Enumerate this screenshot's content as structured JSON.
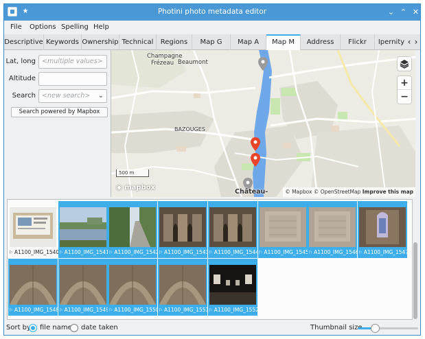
{
  "window": {
    "title": "Photini photo metadata editor",
    "controls": {
      "minimize": "⌄",
      "maximize": "⌃",
      "close": "✕"
    }
  },
  "menubar": [
    "File",
    "Options",
    "Spelling",
    "Help"
  ],
  "tabs": {
    "items": [
      "Descriptive",
      "Keywords",
      "Ownership",
      "Technical",
      "Regions",
      "Map G",
      "Map A",
      "Map M",
      "Address",
      "Flickr",
      "Ipernity"
    ],
    "active": "Map M",
    "scroll_left": "‹",
    "scroll_right": "›"
  },
  "location": {
    "latlong_label": "Lat, long",
    "latlong_placeholder": "<multiple values>",
    "altitude_label": "Altitude",
    "altitude_value": "",
    "search_label": "Search",
    "search_placeholder": "<new search>",
    "search_button": "Search powered by Mapbox"
  },
  "map": {
    "places": [
      "Champagne",
      "Frézeau",
      "Beaumont",
      "BAZOUGES",
      "Château-"
    ],
    "scale": "500 m",
    "zoom_in": "+",
    "zoom_out": "−",
    "logo": "mapbox",
    "attribution": "© Mapbox © OpenStreetMap",
    "improve": "Improve this map",
    "colors": {
      "river": "#6fa8e8",
      "park": "#c8e6b0",
      "urban": "#dedcd2",
      "marker": "#e8442a",
      "marker_grey": "#9a9a9a"
    }
  },
  "thumbnails": [
    {
      "caption": "A1100_IMG_1540",
      "selected": false,
      "scene": "sign"
    },
    {
      "caption": "A1100_IMG_1541",
      "selected": true,
      "scene": "river"
    },
    {
      "caption": "A1100_IMG_1542",
      "selected": true,
      "scene": "path"
    },
    {
      "caption": "A1100_IMG_1543",
      "selected": true,
      "scene": "arches"
    },
    {
      "caption": "A1100_IMG_1544",
      "selected": true,
      "scene": "arches"
    },
    {
      "caption": "A1100_IMG_1545",
      "selected": true,
      "scene": "wall"
    },
    {
      "caption": "A1100_IMG_1546",
      "selected": true,
      "scene": "wall"
    },
    {
      "caption": "A1100_IMG_1547",
      "selected": true,
      "scene": "window"
    },
    {
      "caption": "A1100_IMG_1548",
      "selected": true,
      "scene": "vault"
    },
    {
      "caption": "A1100_IMG_1549",
      "selected": true,
      "scene": "vault"
    },
    {
      "caption": "A1100_IMG_1550",
      "selected": true,
      "scene": "vault"
    },
    {
      "caption": "A1100_IMG_1551",
      "selected": true,
      "scene": "vault"
    },
    {
      "caption": "A1100_IMG_1552",
      "selected": true,
      "scene": "dark"
    }
  ],
  "statusbar": {
    "sort_label": "Sort by",
    "sort_file_name": "file name",
    "sort_date_taken": "date taken",
    "sort_selected": "file name",
    "thumb_size_label": "Thumbnail size",
    "thumb_size_fraction": 0.28
  },
  "accent": "#3daee9"
}
